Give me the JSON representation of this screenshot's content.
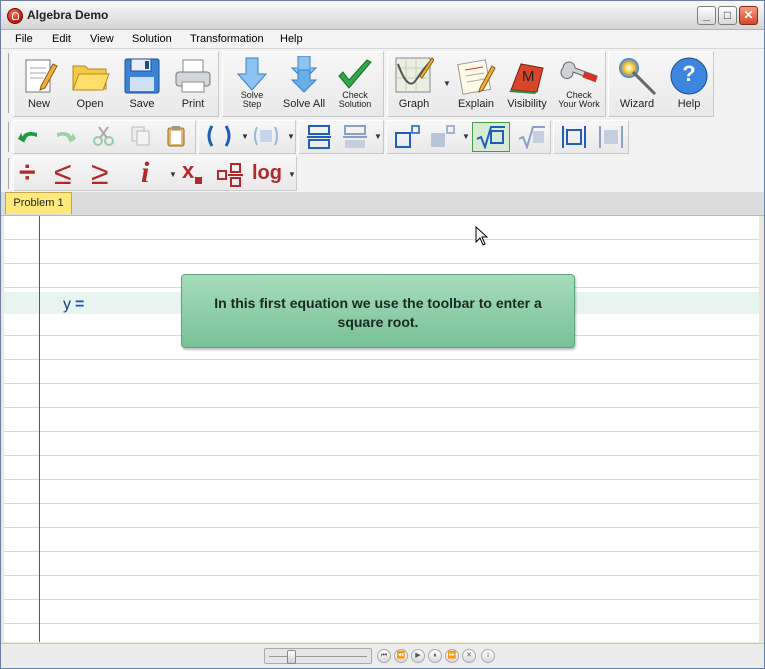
{
  "window": {
    "title": "Algebra Demo",
    "controls": {
      "minimize": "_",
      "maximize": "□",
      "close": "✕"
    }
  },
  "menu": [
    "File",
    "Edit",
    "View",
    "Solution",
    "Transformation",
    "Help"
  ],
  "toolbar_main": {
    "new": "New",
    "open": "Open",
    "save": "Save",
    "print": "Print",
    "solve_step": "Solve\nStep",
    "solve_all": "Solve All",
    "check_solution": "Check\nSolution",
    "graph": "Graph",
    "explain": "Explain",
    "visibility": "Visibility",
    "check_your_work": "Check\nYour Work",
    "wizard": "Wizard",
    "help": "Help",
    "help_glyph": "?",
    "visibility_glyph": "M"
  },
  "toolbar_math": {
    "divide": "÷",
    "less_equal": "≤",
    "greater_equal": "≥",
    "italic_i": "i",
    "subscript_x": "x",
    "log": "log"
  },
  "tabs": [
    "Problem 1"
  ],
  "editor": {
    "equation_var": "y",
    "equation_op": "="
  },
  "tooltip": {
    "text": "In this first equation we use the toolbar to enter a square root."
  },
  "player": {
    "buttons": [
      "⏮",
      "⏪",
      "▶",
      "⏸",
      "⏩",
      "✕",
      "i"
    ]
  },
  "colors": {
    "margin_line": "#c02a2a",
    "tooltip_bg": "#86c9a2",
    "tab_active": "#ffe97a",
    "equation_text": "#1b3d7a"
  }
}
